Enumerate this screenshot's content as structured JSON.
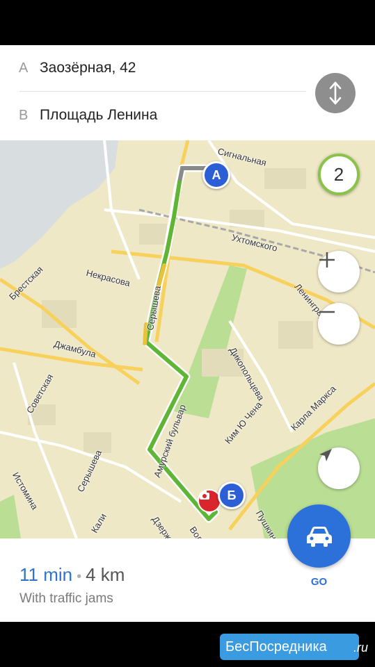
{
  "route": {
    "point_a": {
      "letter": "A",
      "address": "Заозёрная, 42"
    },
    "point_b": {
      "letter": "B",
      "address": "Площадь Ленина"
    },
    "swap_icon": "swap-vertical-icon"
  },
  "map": {
    "traffic_level": "2",
    "streets": [
      "Сигнальная",
      "Ухтомского",
      "Брестская",
      "Некрасова",
      "Ленинград",
      "Серышева",
      "Джамбула",
      "Дикопольцева",
      "Советская",
      "Ким Ю Чена",
      "Карла Маркса",
      "Амурский бульвар",
      "Серышева",
      "Истомина",
      "Пушкина",
      "Дзерж",
      "Вол",
      "Кали"
    ],
    "pin_a": "A",
    "pin_b": "Б",
    "colors": {
      "route_green": "#5fb536",
      "route_yellow": "#e9c23c",
      "route_gray": "#8a8a8a",
      "pin_blue": "#2c5fd6",
      "park_green": "#b9de94"
    }
  },
  "summary": {
    "time": "11 min",
    "separator": "•",
    "distance": "4 km",
    "note": "With traffic jams",
    "go_label": "GO",
    "go_icon": "car-icon"
  },
  "watermark": {
    "text": "БесПосредника",
    "suffix": ".ru"
  }
}
